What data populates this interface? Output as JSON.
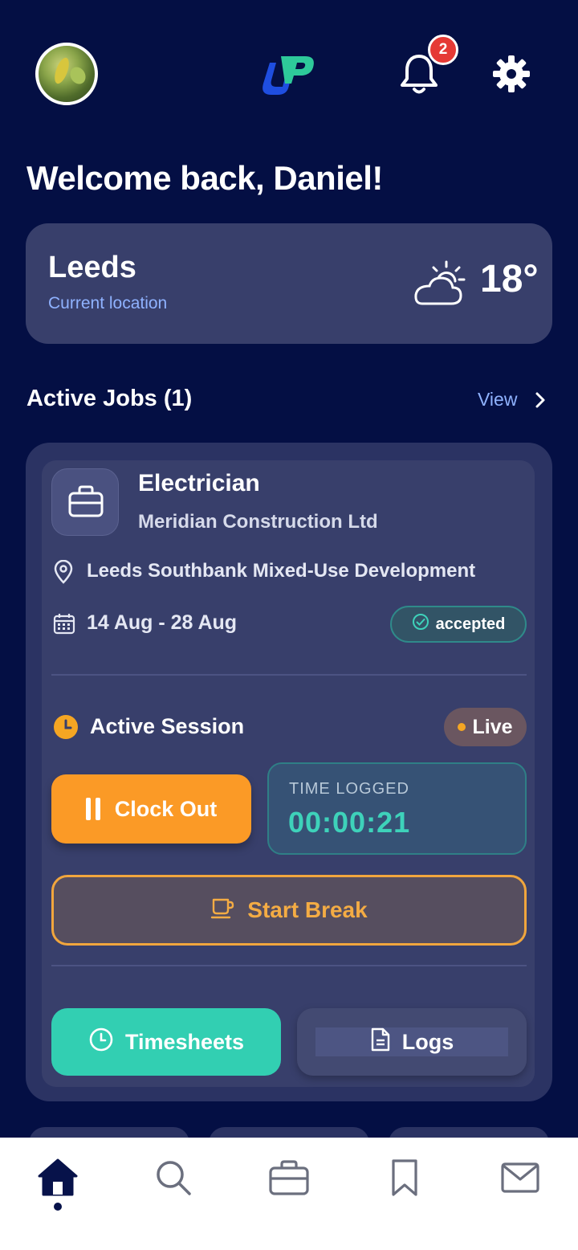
{
  "header": {
    "notification_count": "2"
  },
  "welcome_text": "Welcome back, Daniel!",
  "location": {
    "city": "Leeds",
    "subtitle": "Current location",
    "temperature": "18°",
    "weather_icon": "partly-cloudy-icon"
  },
  "active_jobs": {
    "title": "Active Jobs (1)",
    "view_label": "View"
  },
  "job": {
    "title": "Electrician",
    "company": "Meridian Construction Ltd",
    "site": "Leeds Southbank Mixed-Use Development",
    "dates": "14 Aug - 28 Aug",
    "status": "accepted"
  },
  "session": {
    "label": "Active Session",
    "live_label": "Live",
    "clock_out_label": "Clock Out",
    "time_logged_label": "TIME LOGGED",
    "time_logged_value": "00:00:21",
    "start_break_label": "Start Break"
  },
  "actions": {
    "timesheets_label": "Timesheets",
    "logs_label": "Logs"
  },
  "nav": {
    "items": [
      "home-icon",
      "search-icon",
      "briefcase-icon",
      "bookmark-icon",
      "mail-icon"
    ],
    "active": "home-icon"
  },
  "colors": {
    "background": "#040f44",
    "card": "#383f6b",
    "accent_orange": "#fb9a26",
    "accent_teal": "#32cfb2",
    "link_blue": "#8fb2ff",
    "badge_red": "#e53935"
  }
}
